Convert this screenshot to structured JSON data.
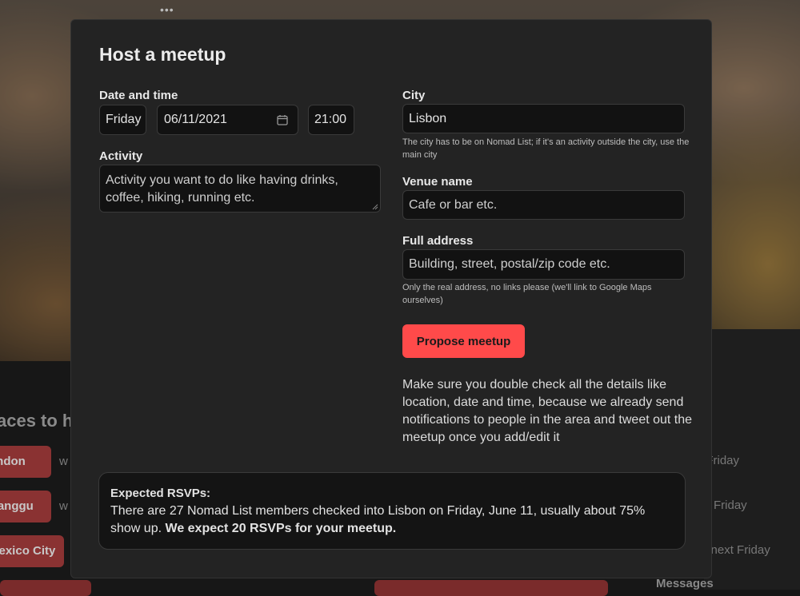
{
  "background": {
    "top_dots": "•••",
    "heading_fragment": "aces to h",
    "cities": [
      "ondon",
      "Canggu",
      "Mexico City"
    ],
    "city_suffix": "w",
    "right_texts": [
      "t Friday",
      "Friday",
      "e next Friday"
    ],
    "messages_label": "Messages"
  },
  "modal": {
    "title": "Host a meetup",
    "date_time": {
      "label": "Date and time",
      "day": "Friday",
      "date": "06/11/2021",
      "time": "21:00"
    },
    "activity": {
      "label": "Activity",
      "placeholder": "Activity you want to do like having drinks, coffee, hiking, running etc."
    },
    "city": {
      "label": "City",
      "value": "Lisbon",
      "hint": "The city has to be on Nomad List; if it's an activity outside the city, use the main city"
    },
    "venue": {
      "label": "Venue name",
      "placeholder": "Cafe or bar etc."
    },
    "address": {
      "label": "Full address",
      "placeholder": "Building, street, postal/zip code etc.",
      "hint": "Only the real address, no links please (we'll link to Google Maps ourselves)"
    },
    "submit_label": "Propose meetup",
    "notice": "Make sure you double check all the details like location, date and time, because we already send notifications to people in the area and tweet out the meetup once you add/edit it",
    "expected": {
      "title": "Expected RSVPs:",
      "text": "There are 27 Nomad List members checked into Lisbon on Friday, June 11, usually about 75% show up.",
      "emphasis": "We expect 20 RSVPs for your meetup."
    }
  },
  "colors": {
    "accent": "#ff4a4a",
    "modal_bg": "#232323",
    "field_bg": "#121212"
  },
  "icons": [
    "calendar-icon",
    "resize-handle-icon"
  ]
}
